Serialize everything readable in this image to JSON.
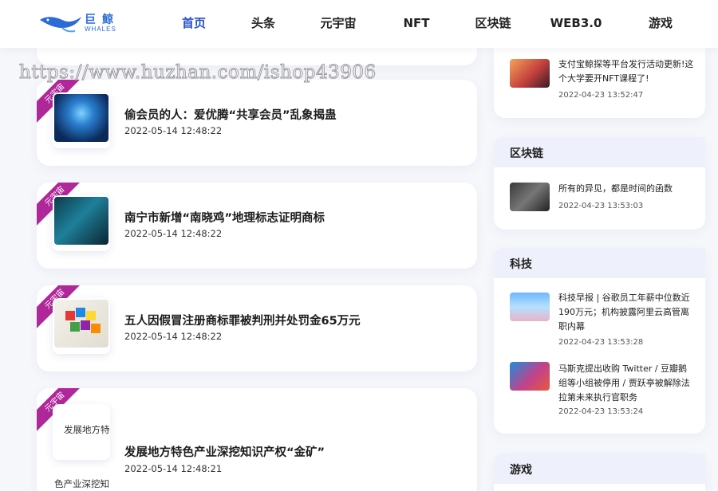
{
  "header": {
    "logo_cn": "巨鲸",
    "logo_en": "WHALES",
    "nav": [
      {
        "label": "首页",
        "active": true
      },
      {
        "label": "头条",
        "active": false
      },
      {
        "label": "元宇宙",
        "active": false
      },
      {
        "label": "NFT",
        "active": false
      },
      {
        "label": "区块链",
        "active": false
      },
      {
        "label": "WEB3.0",
        "active": false
      },
      {
        "label": "游戏",
        "active": false
      }
    ]
  },
  "watermark": "https://www.huzhan.com/ishop43906",
  "articles": [
    {
      "tag": "元宇宙",
      "title": "偷会员的人：爱优腾“共享会员”乱象揭蛊",
      "date": "2022-05-14 12:48:22"
    },
    {
      "tag": "元宇宙",
      "title": "南宁市新增“南晓鸡”地理标志证明商标",
      "date": "2022-05-14 12:48:22"
    },
    {
      "tag": "元宇宙",
      "title": "五人因假冒注册商标罪被判刑并处罚金65万元",
      "date": "2022-05-14 12:48:22"
    },
    {
      "tag": "元宇宙",
      "title": "发展地方特色产业深挖知识产权“金矿”",
      "date": "2022-05-14 12:48:21",
      "alt_line1": "发展地方特",
      "alt_line2": "色产业深挖知"
    }
  ],
  "sidebar": {
    "top_item": {
      "text": "支付宝鲸探等平台发行活动更新!这个大学要开NFT课程了!",
      "date": "2022-04-23 13:52:47"
    },
    "sections": [
      {
        "title": "区块链",
        "items": [
          {
            "text": "所有的异见，都是时间的函数",
            "date": "2022-04-23 13:53:03"
          }
        ]
      },
      {
        "title": "科技",
        "items": [
          {
            "text": "科技早报 | 谷歌员工年薪中位数近190万元；机构披露阿里云高管离职内幕",
            "date": "2022-04-23 13:53:28"
          },
          {
            "text": "马斯克提出收购 Twitter / 豆瓣鹅组等小组被停用 / 贾跃亭被解除法拉第未来执行官职务",
            "date": "2022-04-23 13:53:24"
          }
        ]
      },
      {
        "title": "游戏",
        "items": []
      }
    ]
  },
  "colors": {
    "accent": "#2b54c8",
    "ribbon": "#b0279a",
    "side_head": "#eef0fb",
    "page_bg": "#f6f7fb"
  }
}
